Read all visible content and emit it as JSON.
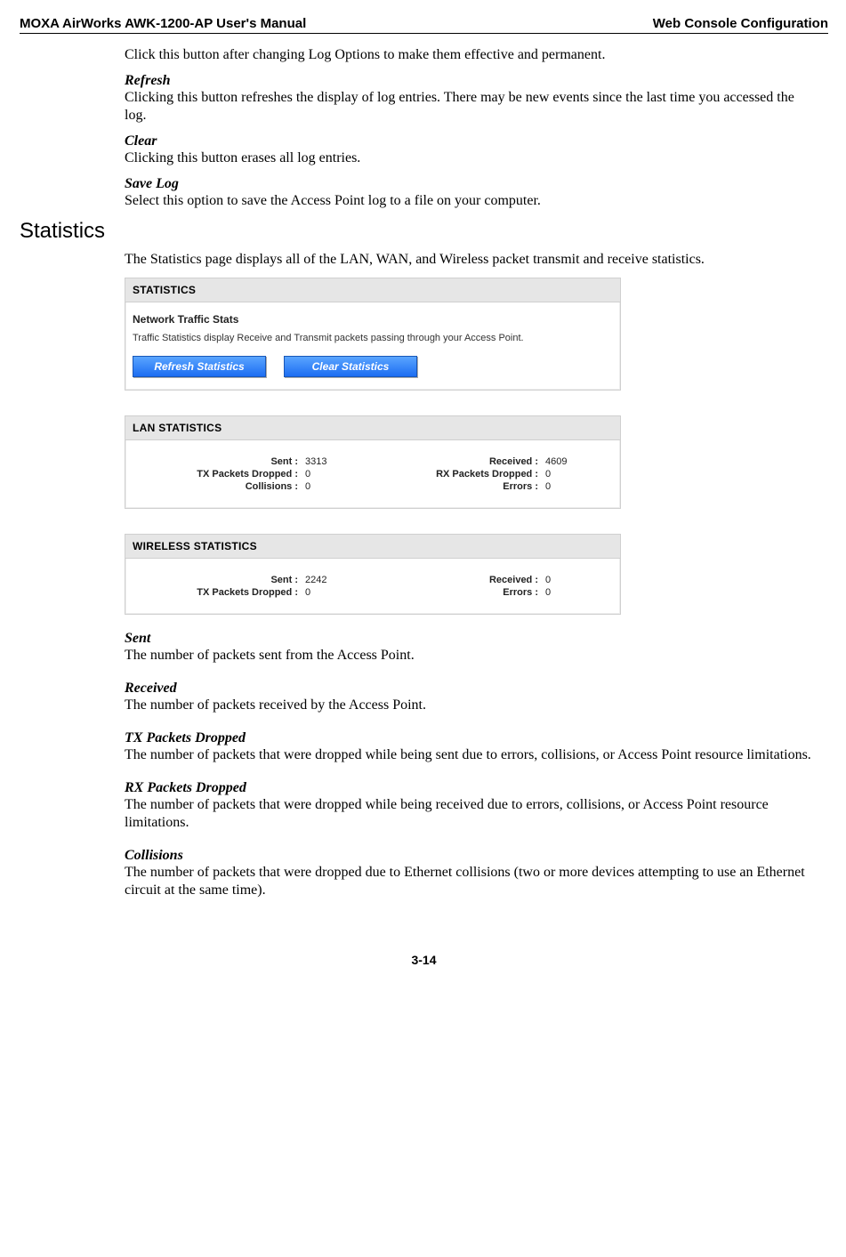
{
  "header": {
    "left": "MOXA AirWorks AWK-1200-AP User's Manual",
    "right": "Web Console Configuration"
  },
  "top_block": {
    "intro": "Click this button after changing Log Options to make them effective and permanent.",
    "refresh_term": "Refresh",
    "refresh_desc": "Clicking this button refreshes the display of log entries. There may be new events since the last time you accessed the log.",
    "clear_term": "Clear",
    "clear_desc": "Clicking this button erases all log entries.",
    "savelog_term": "Save Log",
    "savelog_desc": "Select this option to save the Access Point log to a file on your computer."
  },
  "section": {
    "title": "Statistics",
    "intro": "The Statistics page displays all of the LAN, WAN, and Wireless packet transmit and receive statistics."
  },
  "screenshot": {
    "panel1": {
      "title": "STATISTICS",
      "heading": "Network Traffic Stats",
      "desc": "Traffic Statistics display Receive and Transmit packets passing through your Access Point.",
      "btn_refresh": "Refresh Statistics",
      "btn_clear": "Clear Statistics"
    },
    "panel2": {
      "title": "LAN STATISTICS",
      "r1_l1": "Sent :",
      "r1_v1": "3313",
      "r1_l2": "Received :",
      "r1_v2": "4609",
      "r2_l1": "TX Packets Dropped :",
      "r2_v1": "0",
      "r2_l2": "RX Packets Dropped :",
      "r2_v2": "0",
      "r3_l1": "Collisions :",
      "r3_v1": "0",
      "r3_l2": "Errors :",
      "r3_v2": "0"
    },
    "panel3": {
      "title": "WIRELESS STATISTICS",
      "r1_l1": "Sent :",
      "r1_v1": "2242",
      "r1_l2": "Received :",
      "r1_v2": "0",
      "r2_l1": "TX Packets Dropped :",
      "r2_v1": "0",
      "r2_l2": "Errors :",
      "r2_v2": "0"
    }
  },
  "definitions": {
    "sent_term": "Sent",
    "sent_desc": "The number of packets sent from the Access Point.",
    "received_term": "Received",
    "received_desc": "The number of packets received by the Access Point.",
    "tx_term": "TX Packets Dropped",
    "tx_desc": "The number of packets that were dropped while being sent due to errors, collisions, or Access Point resource limitations.",
    "rx_term": "RX Packets Dropped",
    "rx_desc": "The number of packets that were dropped while being received due to errors, collisions, or Access Point resource limitations.",
    "coll_term": "Collisions",
    "coll_desc": "The number of packets that were dropped due to Ethernet collisions (two or more devices attempting to use an Ethernet circuit at the same time)."
  },
  "footer": "3-14"
}
